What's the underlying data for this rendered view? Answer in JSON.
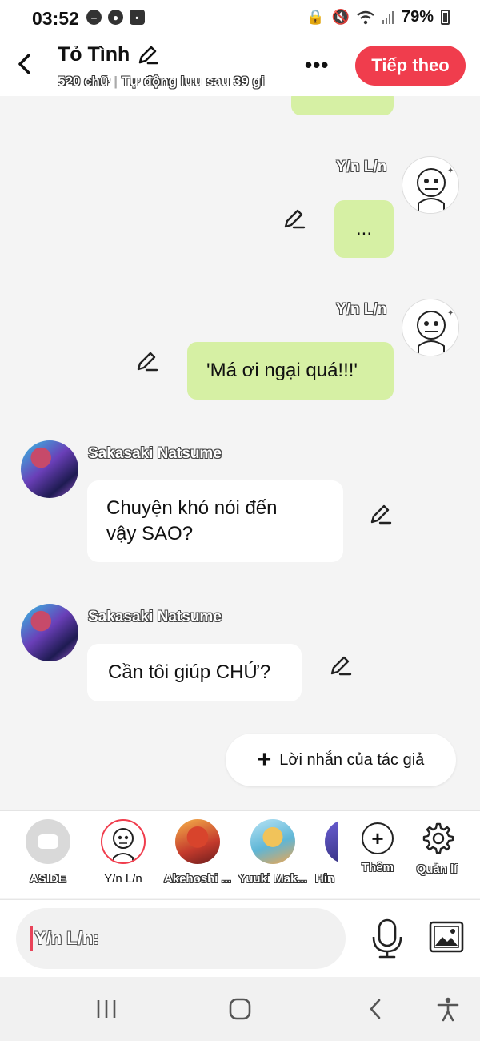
{
  "status_bar": {
    "time": "03:52",
    "battery": "79%",
    "icons": [
      "dnd-icon",
      "account-icon",
      "screenshot-icon",
      "lock-icon",
      "mute-icon",
      "wifi-icon",
      "signal-icon",
      "battery-icon"
    ]
  },
  "header": {
    "title": "Tỏ Tình",
    "words": "520 chữ",
    "autosave": "Tự động lưu sau 39 gi",
    "next_button": "Tiếp theo"
  },
  "messages": [
    {
      "speaker": "Y/n L/n",
      "side": "right",
      "text": "..."
    },
    {
      "speaker": "Y/n L/n",
      "side": "right",
      "text": "'Má ơi ngại quá!!!'"
    },
    {
      "speaker": "Sakasaki Natsume",
      "side": "left",
      "text": "Chuyện khó nói đến vậy SAO?"
    },
    {
      "speaker": "Sakasaki Natsume",
      "side": "left",
      "text": "Cần tôi giúp CHỨ?"
    }
  ],
  "author_note_button": "Lời nhắn của tác giả",
  "characters": [
    {
      "label": "ASIDE"
    },
    {
      "label": "Y/n L/n"
    },
    {
      "label": "Akehoshi ..."
    },
    {
      "label": "Yuuki Mak..."
    },
    {
      "label": "Hin"
    }
  ],
  "tools": {
    "add": "Thêm",
    "manage": "Quản lí"
  },
  "input": {
    "placeholder": "Y/n L/n:"
  },
  "colors": {
    "accent": "#f03d4d",
    "my_bubble": "#d6f0a4",
    "other_bubble": "#ffffff"
  }
}
